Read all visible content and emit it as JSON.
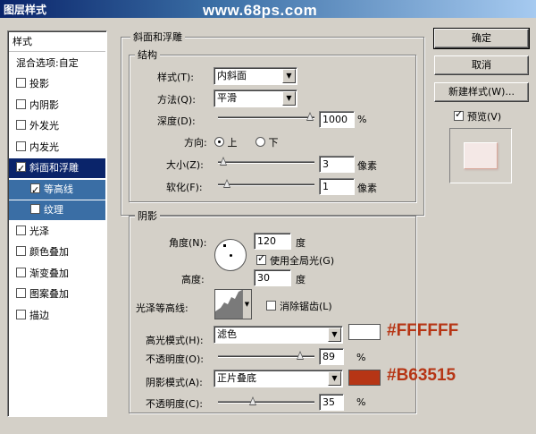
{
  "window": {
    "title": "图层样式"
  },
  "watermark": "www.68ps.com",
  "sidebar": {
    "items": [
      {
        "label": "样式",
        "checkbox": false
      },
      {
        "label": "混合选项:自定",
        "checkbox": false
      },
      {
        "label": "投影",
        "checkbox": true,
        "checked": false
      },
      {
        "label": "内阴影",
        "checkbox": true,
        "checked": false
      },
      {
        "label": "外发光",
        "checkbox": true,
        "checked": false
      },
      {
        "label": "内发光",
        "checkbox": true,
        "checked": false
      },
      {
        "label": "斜面和浮雕",
        "checkbox": true,
        "checked": true,
        "selected": true
      },
      {
        "label": "等高线",
        "checkbox": true,
        "checked": true,
        "sub": true,
        "subselected": true
      },
      {
        "label": "纹理",
        "checkbox": true,
        "checked": false,
        "sub": true,
        "subselected": true
      },
      {
        "label": "光泽",
        "checkbox": true,
        "checked": false
      },
      {
        "label": "颜色叠加",
        "checkbox": true,
        "checked": false
      },
      {
        "label": "渐变叠加",
        "checkbox": true,
        "checked": false
      },
      {
        "label": "图案叠加",
        "checkbox": true,
        "checked": false
      },
      {
        "label": "描边",
        "checkbox": true,
        "checked": false
      }
    ]
  },
  "bevel": {
    "group_title": "斜面和浮雕",
    "structure_title": "结构",
    "style_label": "样式(T):",
    "style_value": "内斜面",
    "technique_label": "方法(Q):",
    "technique_value": "平滑",
    "depth_label": "深度(D):",
    "depth_value": "1000",
    "depth_unit": "%",
    "depth_level": 1.0,
    "direction_label": "方向:",
    "direction_up": "上",
    "direction_down": "下",
    "size_label": "大小(Z):",
    "size_value": "3",
    "size_unit": "像素",
    "size_level": 0.02,
    "soften_label": "软化(F):",
    "soften_value": "1",
    "soften_unit": "像素",
    "soften_level": 0.06
  },
  "shading": {
    "title": "阴影",
    "angle_label": "角度(N):",
    "angle_value": "120",
    "angle_unit": "度",
    "global_light_label": "使用全局光(G)",
    "altitude_label": "高度:",
    "altitude_value": "30",
    "altitude_unit": "度",
    "gloss_contour_label": "光泽等高线:",
    "anti_aliased_label": "消除锯齿(L)",
    "highlight_mode_label": "高光模式(H):",
    "highlight_mode_value": "滤色",
    "highlight_color": "#FFFFFF",
    "highlight_color_label": "#FFFFFF",
    "highlight_opacity_label": "不透明度(O):",
    "highlight_opacity_value": "89",
    "highlight_opacity_level": 0.89,
    "shadow_mode_label": "阴影模式(A):",
    "shadow_mode_value": "正片叠底",
    "shadow_color": "#B63515",
    "shadow_color_label": "#B63515",
    "shadow_opacity_label": "不透明度(C):",
    "shadow_opacity_value": "35",
    "shadow_opacity_level": 0.35,
    "opacity_unit": "%"
  },
  "buttons": {
    "ok": "确定",
    "cancel": "取消",
    "new_style": "新建样式(W)...",
    "preview": "预览(V)"
  },
  "colors": {
    "annotation": "#B63515",
    "selection": "#0a246a"
  }
}
